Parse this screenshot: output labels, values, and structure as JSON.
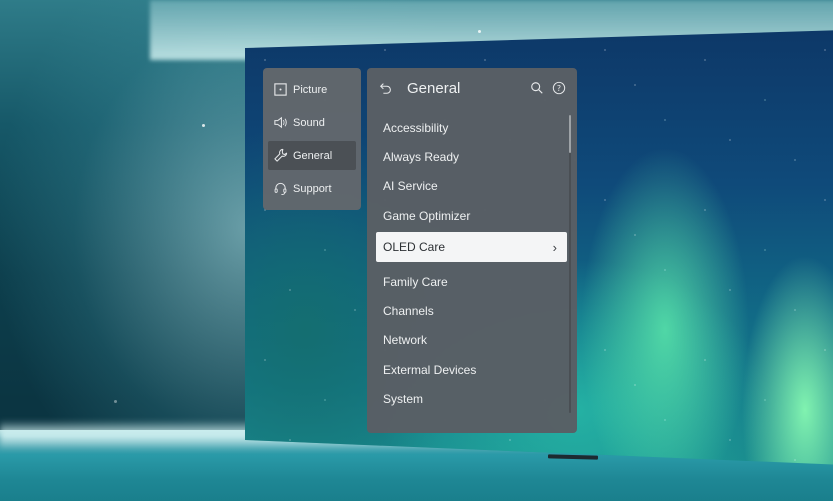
{
  "categories": [
    {
      "label": "Picture",
      "icon": "picture-icon",
      "active": false
    },
    {
      "label": "Sound",
      "icon": "speaker-icon",
      "active": false
    },
    {
      "label": "General",
      "icon": "wrench-icon",
      "active": true
    },
    {
      "label": "Support",
      "icon": "headset-icon",
      "active": false
    }
  ],
  "menu": {
    "title": "General",
    "back_icon": "back-arrow-icon",
    "search_icon": "search-icon",
    "help_icon": "help-icon",
    "help_glyph": "?",
    "chevron_glyph": "›",
    "items": [
      "Accessibility",
      "Always Ready",
      "AI Service",
      "Game Optimizer",
      "OLED Care",
      "Family Care",
      "Channels",
      "Network",
      "Extermal Devices",
      "System"
    ],
    "selected_index": 4,
    "scroll_position": 0
  },
  "colors": {
    "panel_bg": "#595f65",
    "category_panel_bg": "#62676c",
    "selected_bg": "#f4f5f6",
    "text": "#eef0f1"
  }
}
